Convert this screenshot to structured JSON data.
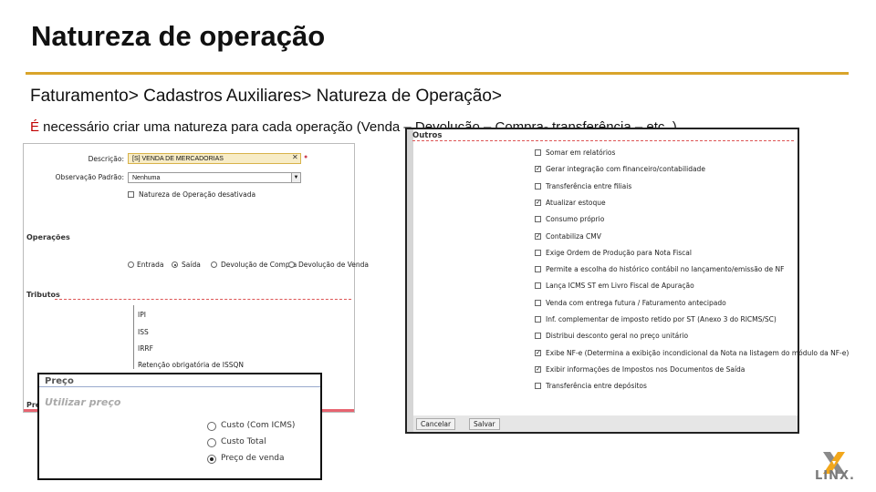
{
  "slide": {
    "title": "Natureza de operação",
    "breadcrumb": "Faturamento> Cadastros Auxiliares> Natureza de Operação>",
    "instruction_first": "É",
    "instruction_rest": " necessário criar uma natureza para cada operação (Venda – Devolução – Compra- transferência – etc..)"
  },
  "left_form": {
    "descricao_label": "Descrição:",
    "descricao_value": "[S] VENDA DE MERCADORIAS",
    "observacao_label": "Observação Padrão:",
    "observacao_value": "Nenhuma",
    "desativada_label": "Natureza de Operação desativada",
    "operacoes_section": "Operações",
    "operacoes": [
      {
        "label": "Entrada",
        "selected": false
      },
      {
        "label": "Saída",
        "selected": true
      },
      {
        "label": "Devolução de Compra",
        "selected": false
      },
      {
        "label": "Devolução de Venda",
        "selected": false
      }
    ],
    "tributos_section": "Tributos",
    "tributos": [
      "IPI",
      "ISS",
      "IRRF",
      "Retenção obrigatória de ISSQN"
    ],
    "prec_partial": "Pre"
  },
  "right_form": {
    "section": "Outros",
    "options": [
      {
        "label": "Somar em relatórios",
        "checked": false
      },
      {
        "label": "Gerar integração com financeiro/contabilidade",
        "checked": true
      },
      {
        "label": "Transferência entre filiais",
        "checked": false
      },
      {
        "label": "Atualizar estoque",
        "checked": true
      },
      {
        "label": "Consumo próprio",
        "checked": false
      },
      {
        "label": "Contabiliza CMV",
        "checked": true
      },
      {
        "label": "Exige Ordem de Produção para Nota Fiscal",
        "checked": false
      },
      {
        "label": "Permite a escolha do histórico contábil no lançamento/emissão de NF",
        "checked": false
      },
      {
        "label": "Lança ICMS ST em Livro Fiscal de Apuração",
        "checked": false
      },
      {
        "label": "Venda com entrega futura / Faturamento antecipado",
        "checked": false
      },
      {
        "label": "Inf. complementar de imposto retido por ST (Anexo 3 do RICMS/SC)",
        "checked": false
      },
      {
        "label": "Distribui desconto geral no preço unitário",
        "checked": false
      },
      {
        "label": "Exibe NF-e (Determina a exibição incondicional da Nota na listagem do módulo da NF-e)",
        "checked": true
      },
      {
        "label": "Exibir informações de Impostos nos Documentos de Saída",
        "checked": true
      },
      {
        "label": "Transferência entre depósitos",
        "checked": false
      }
    ],
    "cancel_label": "Cancelar",
    "save_label": "Salvar"
  },
  "price_form": {
    "title": "Preço",
    "subtitle": "Utilizar preço",
    "options": [
      {
        "label": "Custo (Com ICMS)",
        "selected": false
      },
      {
        "label": "Custo Total",
        "selected": false
      },
      {
        "label": "Preço de venda",
        "selected": true
      }
    ]
  },
  "logo": {
    "text": "LINX."
  }
}
